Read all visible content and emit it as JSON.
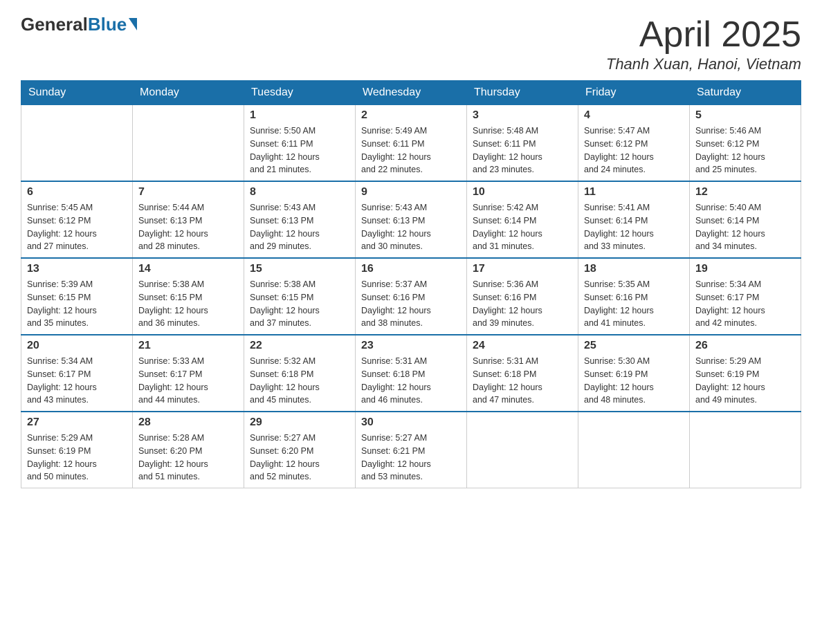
{
  "logo": {
    "general": "General",
    "blue": "Blue"
  },
  "title": "April 2025",
  "location": "Thanh Xuan, Hanoi, Vietnam",
  "headers": [
    "Sunday",
    "Monday",
    "Tuesday",
    "Wednesday",
    "Thursday",
    "Friday",
    "Saturday"
  ],
  "weeks": [
    [
      {
        "day": "",
        "info": ""
      },
      {
        "day": "",
        "info": ""
      },
      {
        "day": "1",
        "info": "Sunrise: 5:50 AM\nSunset: 6:11 PM\nDaylight: 12 hours\nand 21 minutes."
      },
      {
        "day": "2",
        "info": "Sunrise: 5:49 AM\nSunset: 6:11 PM\nDaylight: 12 hours\nand 22 minutes."
      },
      {
        "day": "3",
        "info": "Sunrise: 5:48 AM\nSunset: 6:11 PM\nDaylight: 12 hours\nand 23 minutes."
      },
      {
        "day": "4",
        "info": "Sunrise: 5:47 AM\nSunset: 6:12 PM\nDaylight: 12 hours\nand 24 minutes."
      },
      {
        "day": "5",
        "info": "Sunrise: 5:46 AM\nSunset: 6:12 PM\nDaylight: 12 hours\nand 25 minutes."
      }
    ],
    [
      {
        "day": "6",
        "info": "Sunrise: 5:45 AM\nSunset: 6:12 PM\nDaylight: 12 hours\nand 27 minutes."
      },
      {
        "day": "7",
        "info": "Sunrise: 5:44 AM\nSunset: 6:13 PM\nDaylight: 12 hours\nand 28 minutes."
      },
      {
        "day": "8",
        "info": "Sunrise: 5:43 AM\nSunset: 6:13 PM\nDaylight: 12 hours\nand 29 minutes."
      },
      {
        "day": "9",
        "info": "Sunrise: 5:43 AM\nSunset: 6:13 PM\nDaylight: 12 hours\nand 30 minutes."
      },
      {
        "day": "10",
        "info": "Sunrise: 5:42 AM\nSunset: 6:14 PM\nDaylight: 12 hours\nand 31 minutes."
      },
      {
        "day": "11",
        "info": "Sunrise: 5:41 AM\nSunset: 6:14 PM\nDaylight: 12 hours\nand 33 minutes."
      },
      {
        "day": "12",
        "info": "Sunrise: 5:40 AM\nSunset: 6:14 PM\nDaylight: 12 hours\nand 34 minutes."
      }
    ],
    [
      {
        "day": "13",
        "info": "Sunrise: 5:39 AM\nSunset: 6:15 PM\nDaylight: 12 hours\nand 35 minutes."
      },
      {
        "day": "14",
        "info": "Sunrise: 5:38 AM\nSunset: 6:15 PM\nDaylight: 12 hours\nand 36 minutes."
      },
      {
        "day": "15",
        "info": "Sunrise: 5:38 AM\nSunset: 6:15 PM\nDaylight: 12 hours\nand 37 minutes."
      },
      {
        "day": "16",
        "info": "Sunrise: 5:37 AM\nSunset: 6:16 PM\nDaylight: 12 hours\nand 38 minutes."
      },
      {
        "day": "17",
        "info": "Sunrise: 5:36 AM\nSunset: 6:16 PM\nDaylight: 12 hours\nand 39 minutes."
      },
      {
        "day": "18",
        "info": "Sunrise: 5:35 AM\nSunset: 6:16 PM\nDaylight: 12 hours\nand 41 minutes."
      },
      {
        "day": "19",
        "info": "Sunrise: 5:34 AM\nSunset: 6:17 PM\nDaylight: 12 hours\nand 42 minutes."
      }
    ],
    [
      {
        "day": "20",
        "info": "Sunrise: 5:34 AM\nSunset: 6:17 PM\nDaylight: 12 hours\nand 43 minutes."
      },
      {
        "day": "21",
        "info": "Sunrise: 5:33 AM\nSunset: 6:17 PM\nDaylight: 12 hours\nand 44 minutes."
      },
      {
        "day": "22",
        "info": "Sunrise: 5:32 AM\nSunset: 6:18 PM\nDaylight: 12 hours\nand 45 minutes."
      },
      {
        "day": "23",
        "info": "Sunrise: 5:31 AM\nSunset: 6:18 PM\nDaylight: 12 hours\nand 46 minutes."
      },
      {
        "day": "24",
        "info": "Sunrise: 5:31 AM\nSunset: 6:18 PM\nDaylight: 12 hours\nand 47 minutes."
      },
      {
        "day": "25",
        "info": "Sunrise: 5:30 AM\nSunset: 6:19 PM\nDaylight: 12 hours\nand 48 minutes."
      },
      {
        "day": "26",
        "info": "Sunrise: 5:29 AM\nSunset: 6:19 PM\nDaylight: 12 hours\nand 49 minutes."
      }
    ],
    [
      {
        "day": "27",
        "info": "Sunrise: 5:29 AM\nSunset: 6:19 PM\nDaylight: 12 hours\nand 50 minutes."
      },
      {
        "day": "28",
        "info": "Sunrise: 5:28 AM\nSunset: 6:20 PM\nDaylight: 12 hours\nand 51 minutes."
      },
      {
        "day": "29",
        "info": "Sunrise: 5:27 AM\nSunset: 6:20 PM\nDaylight: 12 hours\nand 52 minutes."
      },
      {
        "day": "30",
        "info": "Sunrise: 5:27 AM\nSunset: 6:21 PM\nDaylight: 12 hours\nand 53 minutes."
      },
      {
        "day": "",
        "info": ""
      },
      {
        "day": "",
        "info": ""
      },
      {
        "day": "",
        "info": ""
      }
    ]
  ]
}
